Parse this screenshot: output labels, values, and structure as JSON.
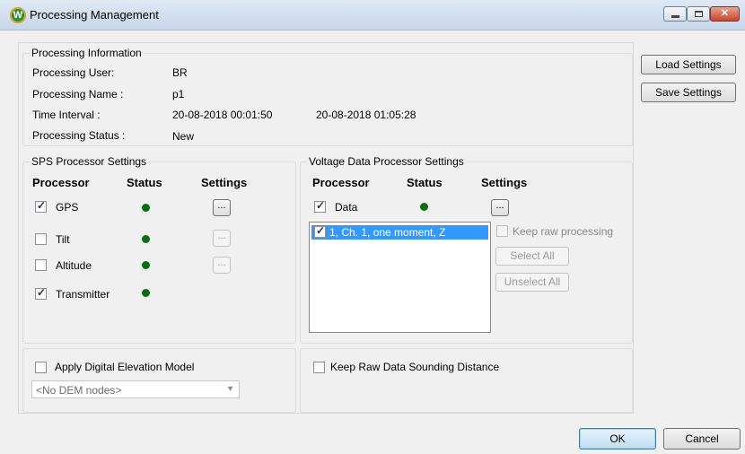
{
  "window": {
    "title": "Processing Management",
    "icon": "app-logo-icon",
    "controls": {
      "minimize": "minimize-icon",
      "maximize": "maximize-icon",
      "close": "✕"
    }
  },
  "processing_info": {
    "group_title": "Processing Information",
    "user_label": "Processing User:",
    "user_value": "BR",
    "name_label": "Processing Name :",
    "name_value": "p1",
    "interval_label": "Time Interval :",
    "interval_start": "20-08-2018 00:01:50",
    "interval_end": "20-08-2018 01:05:28",
    "status_label": "Processing Status :",
    "status_value": "New"
  },
  "sps": {
    "group_title": "SPS Processor Settings",
    "headers": {
      "processor": "Processor",
      "status": "Status",
      "settings": "Settings"
    },
    "rows": [
      {
        "name": "GPS",
        "checked": true,
        "status_color": "#0b6b16",
        "settings_label": "...",
        "settings_enabled": true
      },
      {
        "name": "Tilt",
        "checked": false,
        "status_color": "#0b6b16",
        "settings_label": "...",
        "settings_enabled": false
      },
      {
        "name": "Altitude",
        "checked": false,
        "status_color": "#0b6b16",
        "settings_label": "...",
        "settings_enabled": false
      },
      {
        "name": "Transmitter",
        "checked": true,
        "status_color": "#0b6b16"
      }
    ]
  },
  "voltage": {
    "group_title": "Voltage Data Processor Settings",
    "headers": {
      "processor": "Processor",
      "status": "Status",
      "settings": "Settings"
    },
    "data_row": {
      "name": "Data",
      "checked": true,
      "status_color": "#0b6b16",
      "settings_label": "..."
    },
    "list_items": [
      {
        "label": "1, Ch. 1, one moment, Z",
        "checked": true,
        "selected": true
      }
    ],
    "keep_raw_processing": "Keep raw processing",
    "select_all": "Select All",
    "unselect_all": "Unselect All"
  },
  "dem": {
    "checkbox_label": "Apply Digital Elevation Model",
    "combo_value": "<No DEM nodes>"
  },
  "keep_raw_sounding": "Keep Raw Data Sounding Distance",
  "side_buttons": {
    "load": "Load Settings",
    "save": "Save Settings"
  },
  "footer": {
    "ok": "OK",
    "cancel": "Cancel"
  },
  "colors": {
    "accent": "#3399ff",
    "status_ok": "#0b6b16"
  }
}
